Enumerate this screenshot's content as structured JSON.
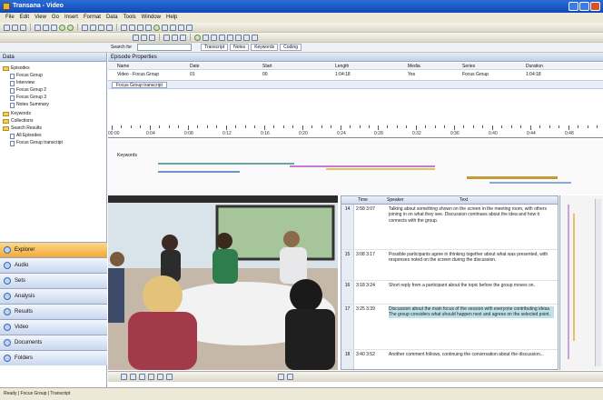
{
  "window": {
    "title": "Transana - Video"
  },
  "menu": [
    "File",
    "Edit",
    "View",
    "Go",
    "Insert",
    "Format",
    "Data",
    "Tools",
    "Window",
    "Help"
  ],
  "filter_bar": {
    "search_label": "Search for",
    "tabs": [
      "Transcript",
      "Notes",
      "Keywords",
      "Coding"
    ]
  },
  "left_panel": {
    "header": "Data",
    "tree": [
      {
        "label": "Episodes",
        "level": 0,
        "type": "folder"
      },
      {
        "label": "Focus Group",
        "level": 1,
        "type": "doc"
      },
      {
        "label": "Interview",
        "level": 1,
        "type": "doc"
      },
      {
        "label": "Focus Group 2",
        "level": 1,
        "type": "doc"
      },
      {
        "label": "Focus Group 3",
        "level": 1,
        "type": "doc"
      },
      {
        "label": "Notes Summary",
        "level": 1,
        "type": "doc"
      },
      {
        "label": "Keywords",
        "level": 0,
        "type": "folder"
      },
      {
        "label": "Collections",
        "level": 0,
        "type": "folder"
      },
      {
        "label": "Search Results",
        "level": 0,
        "type": "folder"
      },
      {
        "label": "All Episodes",
        "level": 1,
        "type": "doc"
      },
      {
        "label": "Focus Group transcript",
        "level": 1,
        "type": "doc"
      }
    ],
    "nav_buttons": [
      "Explorer",
      "Audio",
      "Sets",
      "Analysis",
      "Results",
      "Video",
      "Documents",
      "Folders"
    ]
  },
  "main": {
    "episode_header": "Episode Properties",
    "table_headers": [
      "Name",
      "Date",
      "Start",
      "Length",
      "Media",
      "Series",
      "Duration"
    ],
    "table_row": [
      "Video - Focus Group",
      "01",
      "00",
      "1:04:18",
      "Yes",
      "Focus Group",
      "1:04:18"
    ],
    "selection_label": "Focus Group transcript",
    "ruler_labels": [
      "00:00",
      "0:04",
      "0:08",
      "0:12",
      "0:16",
      "0:20",
      "0:24",
      "0:28",
      "0:32",
      "0:36",
      "0:40",
      "0:44",
      "0:48"
    ],
    "timeline_label": "Keywords",
    "transcript": {
      "headers": [
        "Time",
        "Speaker",
        "Text"
      ],
      "rows": [
        {
          "num": "14",
          "time": "2:58 3:07",
          "text": "Talking about something shown on the screen in the meeting room, with others joining in on what they see. Discussion continues about the idea and how it connects with the group.",
          "highlight": false
        },
        {
          "num": "15",
          "time": "3:08 3:17",
          "text": "Possible participants agree in thinking together about what was presented, with responses noted on the screen during the discussion.",
          "highlight": false
        },
        {
          "num": "16",
          "time": "3:18 3:24",
          "text": "Short reply from a participant about the topic before the group moves on.",
          "highlight": false
        },
        {
          "num": "17",
          "time": "3:25 3:39",
          "text": "Discussion about the main focus of the session with everyone contributing ideas. The group considers what should happen next and agrees on the selected point.",
          "highlight": true
        },
        {
          "num": "18",
          "time": "3:40 3:52",
          "text": "Another comment follows, continuing the conversation about the discussion...",
          "highlight": false
        }
      ]
    }
  },
  "status": "Ready  |  Focus Group  |  Transcript"
}
